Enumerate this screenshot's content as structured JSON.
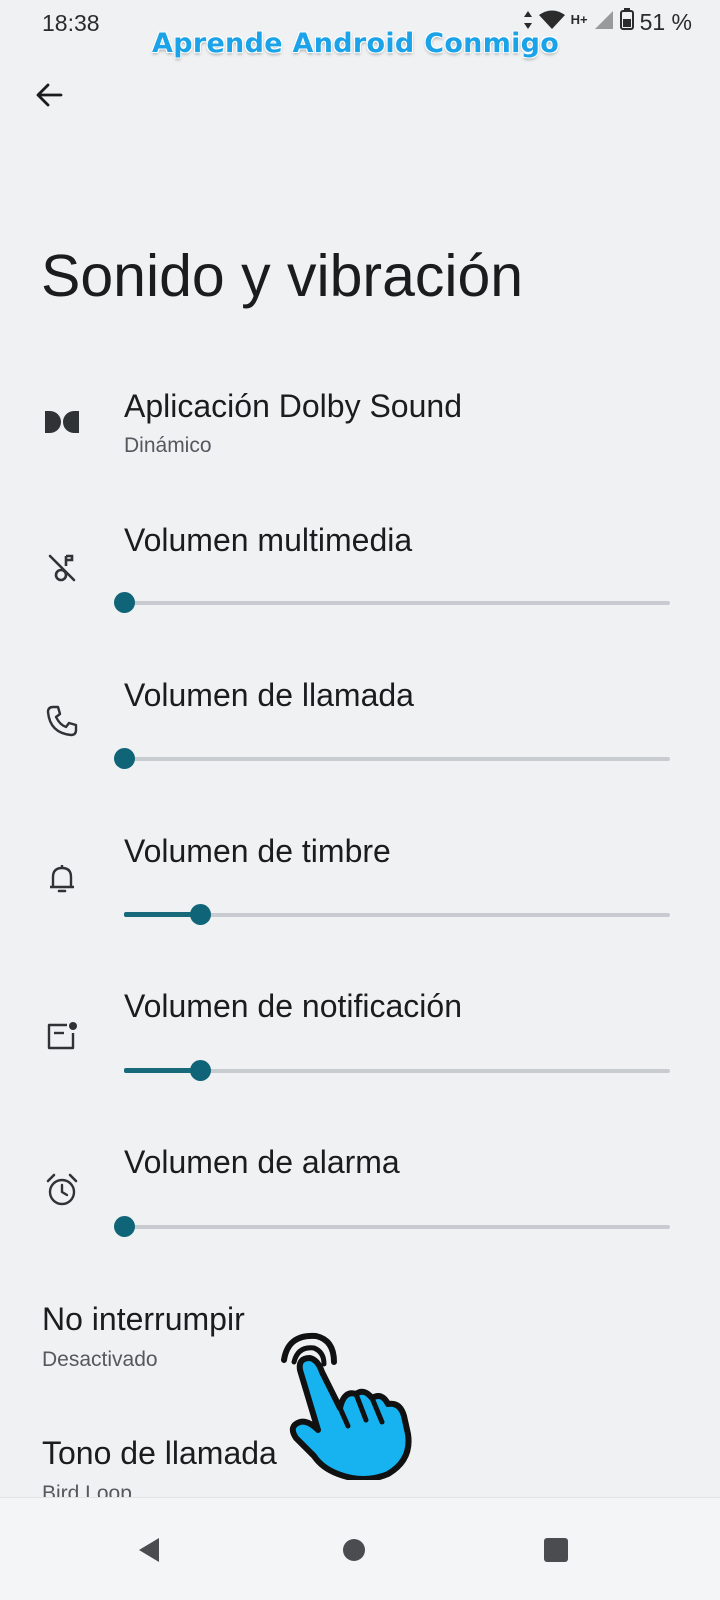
{
  "status": {
    "time": "18:38",
    "network": "H+",
    "battery": "51 %"
  },
  "watermark": "Aprende Android Conmigo",
  "title": "Sonido y vibración",
  "dolby": {
    "label": "Aplicación Dolby Sound",
    "sub": "Dinámico"
  },
  "volumes": [
    {
      "label": "Volumen multimedia",
      "level": 0.0,
      "icon": "music-off-icon"
    },
    {
      "label": "Volumen de llamada",
      "level": 0.0,
      "icon": "phone-icon"
    },
    {
      "label": "Volumen de timbre",
      "level": 0.14,
      "icon": "bell-icon"
    },
    {
      "label": "Volumen de notificación",
      "level": 0.14,
      "icon": "notification-icon"
    },
    {
      "label": "Volumen de alarma",
      "level": 0.0,
      "icon": "alarm-icon"
    }
  ],
  "dnd": {
    "label": "No interrumpir",
    "sub": "Desactivado"
  },
  "ringtone": {
    "label": "Tono de llamada",
    "sub": "Bird Loop"
  },
  "colors": {
    "accent": "#0f6478",
    "background": "#eff1f3",
    "watermark": "#1aa3e8"
  }
}
